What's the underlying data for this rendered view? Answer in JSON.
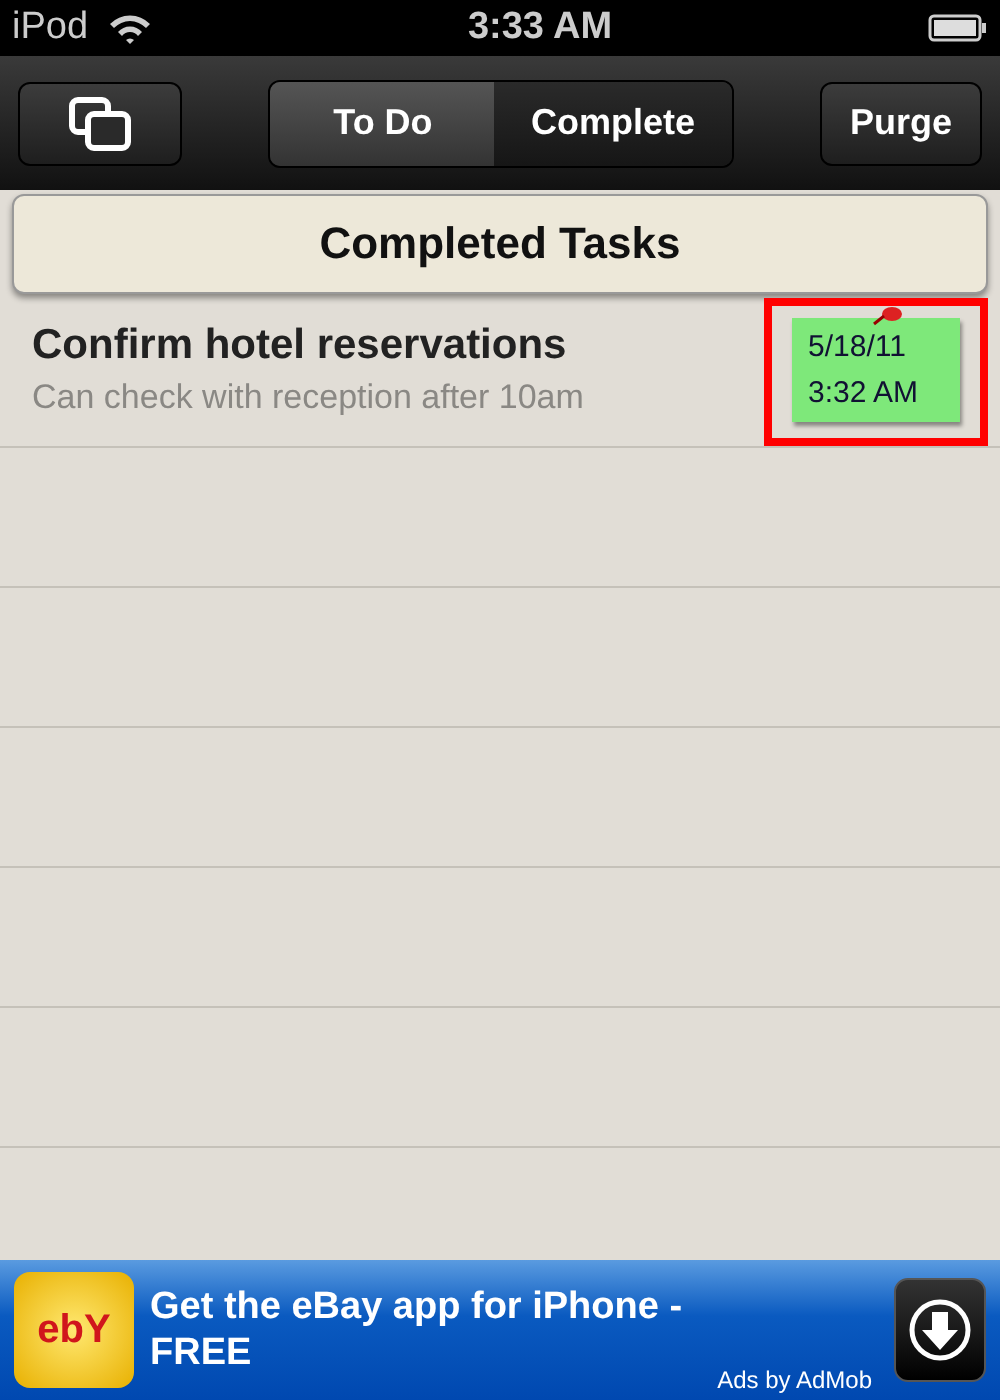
{
  "status_bar": {
    "carrier": "iPod",
    "time": "3:33 AM"
  },
  "toolbar": {
    "segments": [
      {
        "label": "To Do",
        "selected": false
      },
      {
        "label": "Complete",
        "selected": true
      }
    ],
    "purge_button": "Purge"
  },
  "list_title": "Completed Tasks",
  "tasks": [
    {
      "title": "Confirm hotel reservations",
      "note": "Can check with reception after 10am",
      "date": "5/18/11",
      "time": "3:32 AM",
      "highlighted": true
    }
  ],
  "ad": {
    "logo": "ebY",
    "headline": "Get the eBay app for iPhone - FREE",
    "attribution": "Ads by AdMob"
  }
}
